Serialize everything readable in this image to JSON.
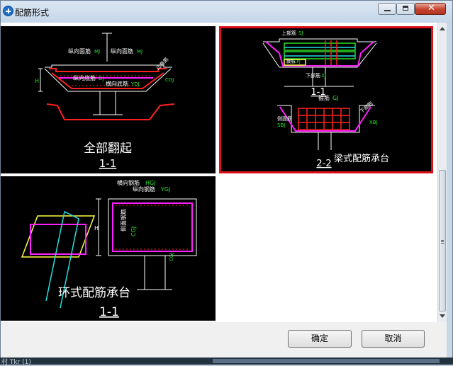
{
  "window": {
    "title": "配筋形式"
  },
  "tiles": [
    {
      "id": "all-bent-up",
      "name": "全部翻起",
      "section": "1-1",
      "labels": {
        "top_long": "纵向面筋",
        "top_long_code": "MJ",
        "top_trans": "纵向面筋",
        "top_trans_code": "MJ",
        "side_bar": "边角筋",
        "side_code": "CGJ",
        "bottom_long": "纵向底筋",
        "bottom_long_code": "DJ",
        "bottom_trans": "横向底筋",
        "bottom_trans_code": "YDJ",
        "height": "H"
      }
    },
    {
      "id": "beam-type",
      "name": "梁式配筋承台",
      "section_top": "1-1",
      "section_bottom": "2-2",
      "selected": true,
      "labels": {
        "top": "上部筋",
        "top_code": "SJ",
        "waist": "腰筋",
        "waist_code": "LPJ",
        "bottom": "下部筋",
        "bottom_code": "XJ",
        "stirrup": "箍筋",
        "stirrup_code": "GJ",
        "side": "侧面筋",
        "side_code": "SBJ",
        "side2": "下部筋",
        "side2_code": "XBJ"
      }
    },
    {
      "id": "ring-type",
      "name": "环式配筋承台",
      "section": "1-1",
      "labels": {
        "horizontal": "横向钢筋",
        "horizontal_code": "HGJ",
        "vertical": "纵向钢筋",
        "vertical_code": "YGJ",
        "side": "侧面钢筋",
        "side_code": "CGJ",
        "side_code2": "CGJ",
        "height": "H"
      }
    }
  ],
  "buttons": {
    "ok": "确定",
    "cancel": "取消"
  },
  "taskbar": {
    "text": "村 Tkr (1)"
  },
  "colors": {
    "selected_border": "#e0101a",
    "rebar_red": "#ff2020",
    "rebar_magenta": "#ff20ff",
    "dim_white": "#ffffff",
    "code_green": "#28e028",
    "accent_yellow": "#ffff40",
    "accent_cyan": "#20e0e0"
  }
}
